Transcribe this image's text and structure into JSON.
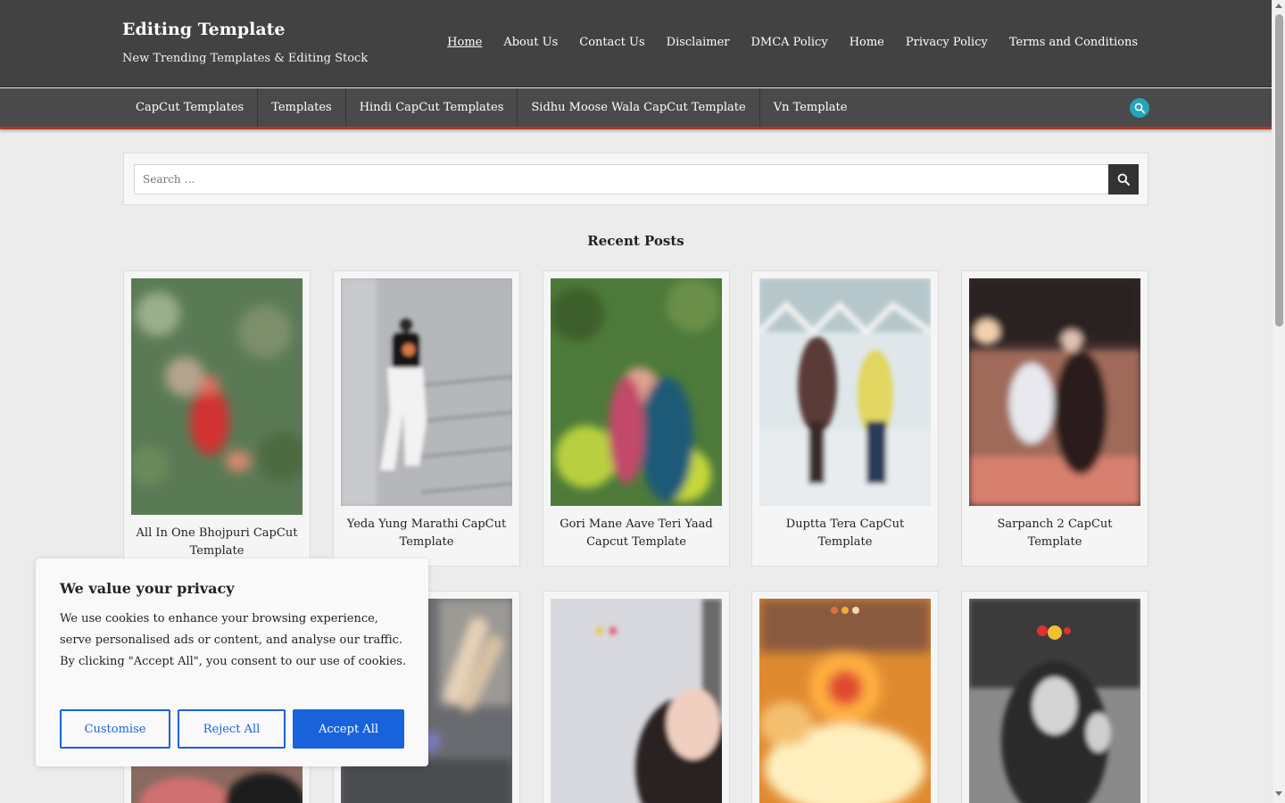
{
  "header": {
    "site_title": "Editing Template",
    "tagline": "New Trending Templates & Editing Stock",
    "menu": [
      {
        "label": "Home",
        "active": true
      },
      {
        "label": "About Us"
      },
      {
        "label": "Contact Us"
      },
      {
        "label": "Disclaimer"
      },
      {
        "label": "DMCA Policy"
      },
      {
        "label": "Home"
      },
      {
        "label": "Privacy Policy"
      },
      {
        "label": "Terms and Conditions"
      }
    ]
  },
  "category_nav": {
    "items": [
      {
        "label": "CapCut Templates"
      },
      {
        "label": "Templates"
      },
      {
        "label": "Hindi CapCut Templates"
      },
      {
        "label": "Sidhu Moose Wala CapCut Template"
      },
      {
        "label": "Vn Template"
      }
    ],
    "search_icon": "search-icon",
    "accent_color": "#27a3b9",
    "underline_color": "#b0352b"
  },
  "search": {
    "placeholder": "Search …",
    "submit_icon": "search-icon"
  },
  "recent_posts": {
    "title": "Recent Posts",
    "row1": [
      {
        "title": "All In One Bhojpuri CapCut Template"
      },
      {
        "title": "Yeda Yung Marathi CapCut Template"
      },
      {
        "title": "Gori Mane Aave Teri Yaad Capcut Template"
      },
      {
        "title": "Duptta Tera CapCut Template"
      },
      {
        "title": "Sarpanch 2 CapCut Template"
      }
    ]
  },
  "cookie_banner": {
    "title": "We value your privacy",
    "text": "We use cookies to enhance your browsing experience, serve personalised ads or content, and analyse our traffic. By clicking \"Accept All\", you consent to our use of cookies.",
    "customise_label": "Customise",
    "reject_label": "Reject All",
    "accept_label": "Accept All",
    "brand_color": "#1863dc"
  }
}
